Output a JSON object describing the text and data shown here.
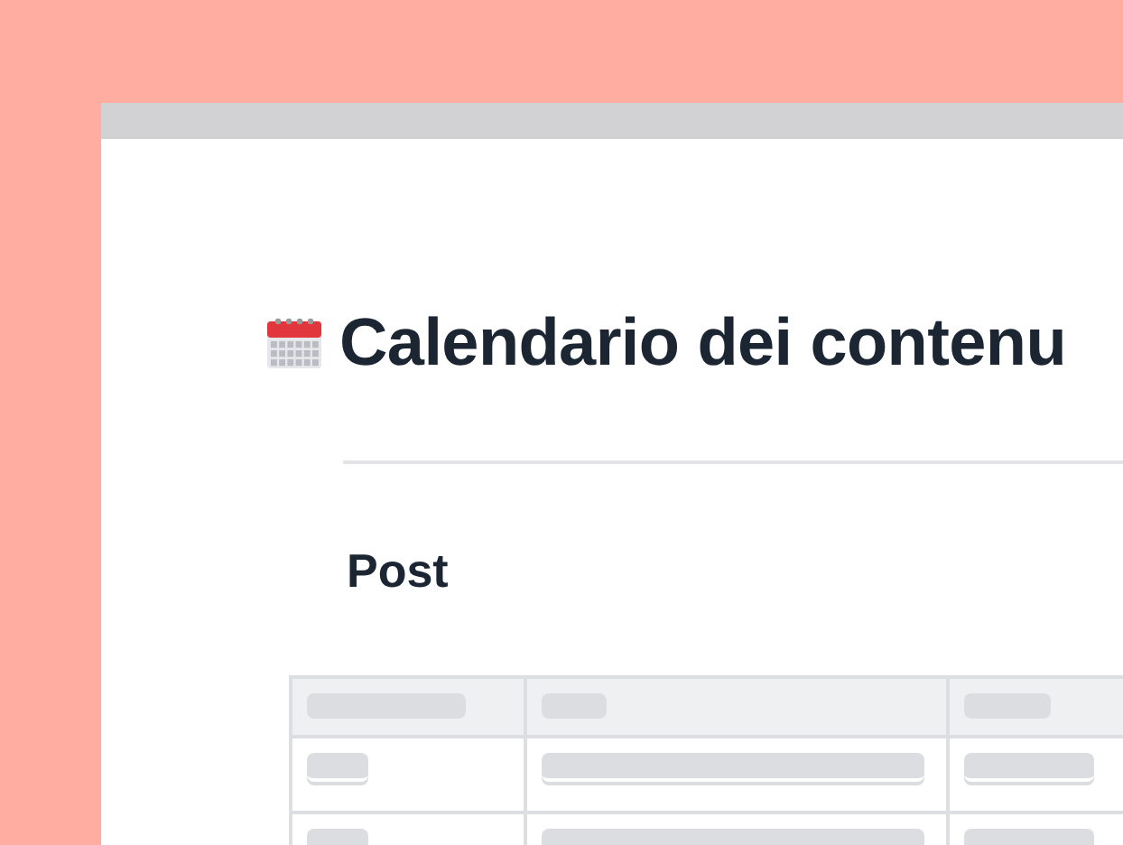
{
  "page": {
    "title": "Calendario dei contenu",
    "section_heading": "Post"
  }
}
